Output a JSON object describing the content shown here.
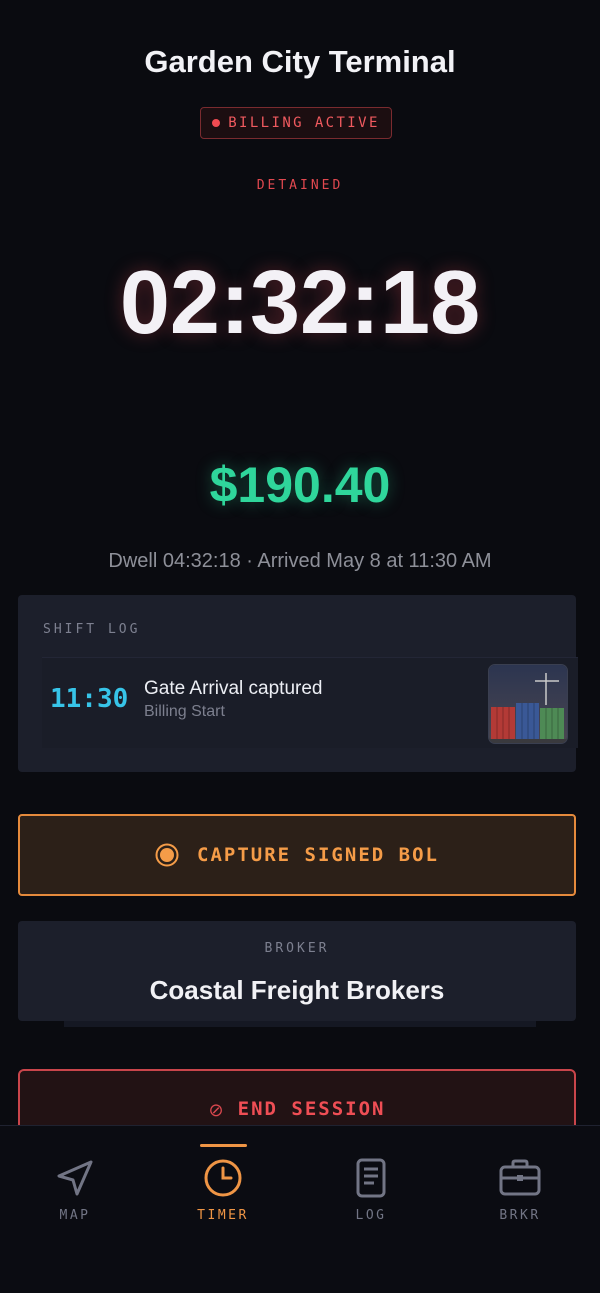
{
  "header": {
    "title": "Garden City Terminal",
    "billing_badge": "BILLING ACTIVE",
    "status": "DETAINED"
  },
  "timer": {
    "value": "02:32:18"
  },
  "charges": {
    "amount": "$190.40"
  },
  "dwell_line": "Dwell 04:32:18 · Arrived May 8 at 11:30 AM",
  "shift_log": {
    "label": "SHIFT LOG",
    "entries": [
      {
        "time": "11:30",
        "title": "Gate Arrival captured",
        "subtitle": "Billing Start",
        "thumbnail": "container-yard-photo"
      }
    ]
  },
  "capture_button": {
    "label": "CAPTURE SIGNED BOL",
    "icon": "record-icon"
  },
  "broker": {
    "label": "BROKER",
    "name": "Coastal Freight Brokers"
  },
  "end_button": {
    "label": "END SESSION",
    "icon": "no-entry-icon"
  },
  "nav": {
    "items": [
      {
        "label": "MAP",
        "icon": "navigation-arrow-icon"
      },
      {
        "label": "TIMER",
        "icon": "clock-icon",
        "active": true
      },
      {
        "label": "LOG",
        "icon": "document-icon"
      },
      {
        "label": "BRKR",
        "icon": "briefcase-icon"
      }
    ]
  },
  "colors": {
    "background": "#0a0b10",
    "alert": "#ef4e55",
    "money": "#2fd69b",
    "accent": "#ef9545",
    "time": "#37c4e8"
  }
}
